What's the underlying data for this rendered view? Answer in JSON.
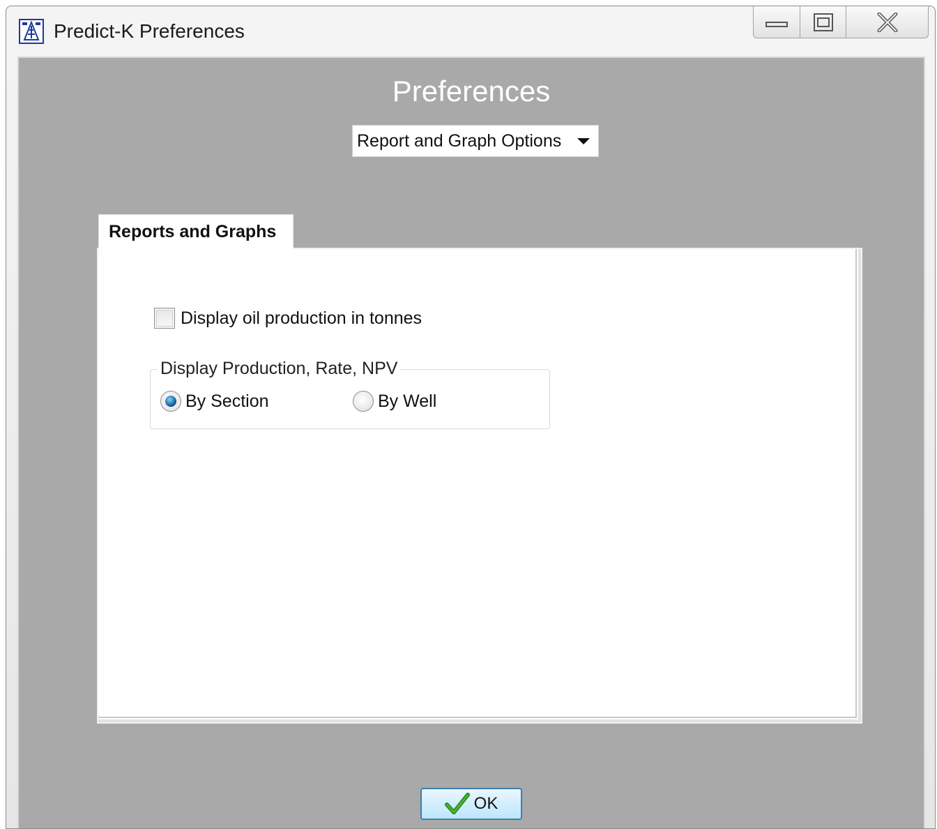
{
  "window": {
    "title": "Predict-K Preferences"
  },
  "heading": "Preferences",
  "category_dropdown": {
    "selected": "Report and Graph Options"
  },
  "tab": {
    "label": "Reports and Graphs"
  },
  "options": {
    "tonnes_checkbox": {
      "label": "Display oil production in tonnes",
      "checked": false
    },
    "display_group": {
      "legend": "Display Production, Rate, NPV",
      "radios": [
        {
          "label": "By Section",
          "selected": true
        },
        {
          "label": "By Well",
          "selected": false
        }
      ]
    }
  },
  "ok_button": {
    "label": "OK",
    "icon": "checkmark-icon"
  },
  "colors": {
    "client_background": "#a9a9a9",
    "heading_text": "#ffffff",
    "ok_checkmark": "#2e8b1f"
  }
}
